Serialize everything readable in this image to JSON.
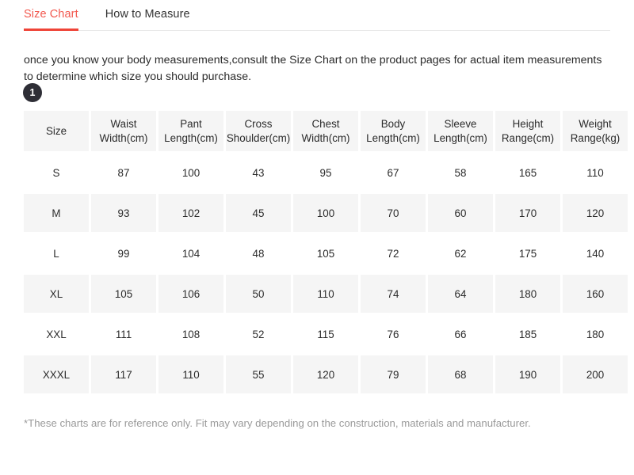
{
  "tabs": [
    {
      "label": "Size Chart",
      "active": true
    },
    {
      "label": "How to Measure",
      "active": false
    }
  ],
  "intro_text": "once you know your body measurements,consult the Size Chart on the product pages for actual item measurements to determine which size you should purchase.",
  "step_badge": "1",
  "footnote": "*These charts are for reference only. Fit may vary depending on the construction, materials and manufacturer.",
  "colors": {
    "accent": "#ef4438",
    "tab_active_text": "#f2594f",
    "cell_shaded": "#f5f5f5",
    "badge_bg": "#2e2e36",
    "footnote_text": "#9a9a9a"
  },
  "chart_data": {
    "type": "table",
    "title": "Size Chart",
    "columns": [
      {
        "line1": "Size",
        "line2": ""
      },
      {
        "line1": "Waist",
        "line2": "Width(cm)"
      },
      {
        "line1": "Pant",
        "line2": "Length(cm)"
      },
      {
        "line1": "Cross",
        "line2": "Shoulder(cm)"
      },
      {
        "line1": "Chest",
        "line2": "Width(cm)"
      },
      {
        "line1": "Body",
        "line2": "Length(cm)"
      },
      {
        "line1": "Sleeve",
        "line2": "Length(cm)"
      },
      {
        "line1": "Height",
        "line2": "Range(cm)"
      },
      {
        "line1": "Weight",
        "line2": "Range(kg)"
      }
    ],
    "rows": [
      {
        "cells": [
          "S",
          "87",
          "100",
          "43",
          "95",
          "67",
          "58",
          "165",
          "110"
        ],
        "shaded": false
      },
      {
        "cells": [
          "M",
          "93",
          "102",
          "45",
          "100",
          "70",
          "60",
          "170",
          "120"
        ],
        "shaded": true
      },
      {
        "cells": [
          "L",
          "99",
          "104",
          "48",
          "105",
          "72",
          "62",
          "175",
          "140"
        ],
        "shaded": false
      },
      {
        "cells": [
          "XL",
          "105",
          "106",
          "50",
          "110",
          "74",
          "64",
          "180",
          "160"
        ],
        "shaded": true
      },
      {
        "cells": [
          "XXL",
          "111",
          "108",
          "52",
          "115",
          "76",
          "66",
          "185",
          "180"
        ],
        "shaded": false
      },
      {
        "cells": [
          "XXXL",
          "117",
          "110",
          "55",
          "120",
          "79",
          "68",
          "190",
          "200"
        ],
        "shaded": true
      }
    ]
  }
}
